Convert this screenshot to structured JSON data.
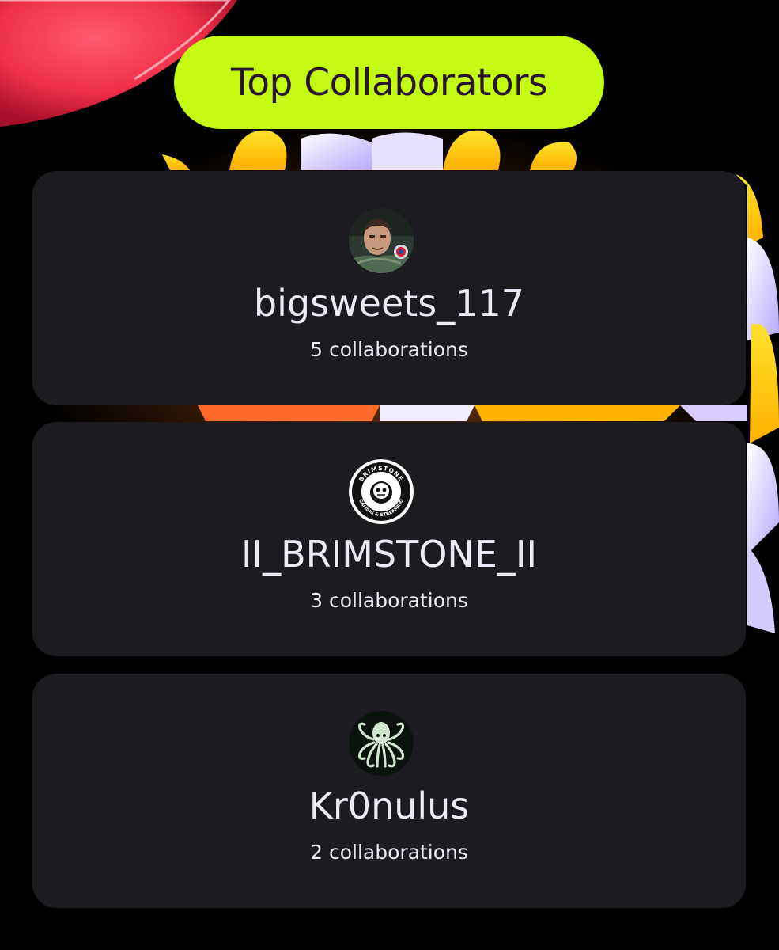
{
  "header": {
    "title": "Top Collaborators"
  },
  "collaborators": [
    {
      "name": "bigsweets_117",
      "count_label": "5 collaborations",
      "avatar_icon": "astronaut-portrait"
    },
    {
      "name": "II_BRIMSTONE_II",
      "count_label": "3 collaborations",
      "avatar_icon": "brimstone-gaming-logo"
    },
    {
      "name": "Kr0nulus",
      "count_label": "2 collaborations",
      "avatar_icon": "octopus-logo"
    }
  ],
  "avatar_text": {
    "brimstone_top": "BRIMSTONE",
    "brimstone_bottom": "GAMING & STREAMING"
  },
  "colors": {
    "accent": "#c4fb12",
    "card_bg": "#1b1b20",
    "page_bg": "#000000",
    "title_text": "#2a1530",
    "text": "#ecebf5"
  }
}
